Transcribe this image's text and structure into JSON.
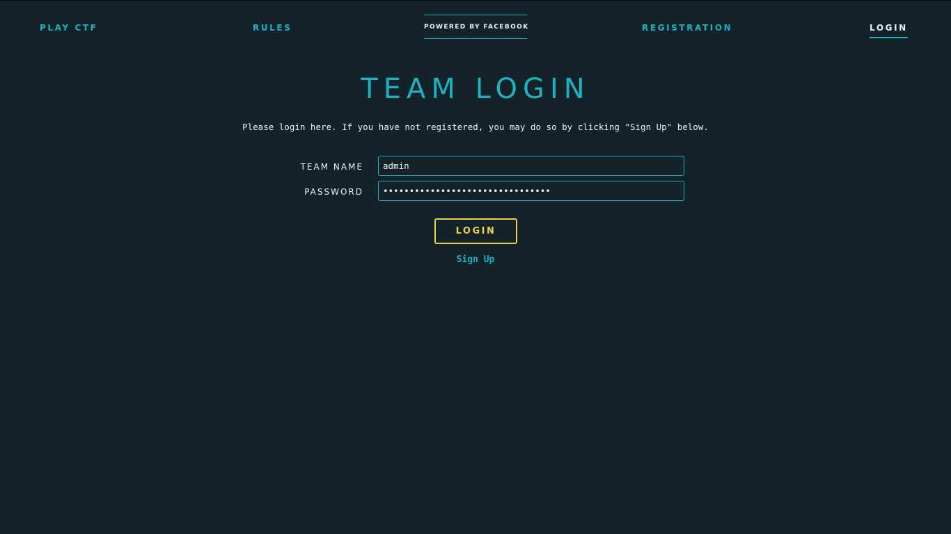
{
  "nav": {
    "items": [
      {
        "label": "PLAY CTF"
      },
      {
        "label": "RULES"
      },
      {
        "label": "REGISTRATION"
      },
      {
        "label": "LOGIN",
        "active": true
      }
    ],
    "badge": {
      "label": "POWERED BY FACEBOOK",
      "icon": "facebook-icon"
    }
  },
  "main": {
    "title": "TEAM LOGIN",
    "intro": "Please login here. If you have not registered, you may do so by clicking \"Sign Up\" below.",
    "form": {
      "team_name_label": "TEAM NAME",
      "team_name_value": "admin",
      "password_label": "PASSWORD",
      "password_value": "••••••••••••••••••••••••••••••••",
      "submit_label": "LOGIN"
    },
    "signup_label": "Sign Up"
  },
  "colors": {
    "background": "#14232a",
    "accent": "#1fb1c1",
    "button": "#e8d44a",
    "text": "#e9f3f5"
  }
}
